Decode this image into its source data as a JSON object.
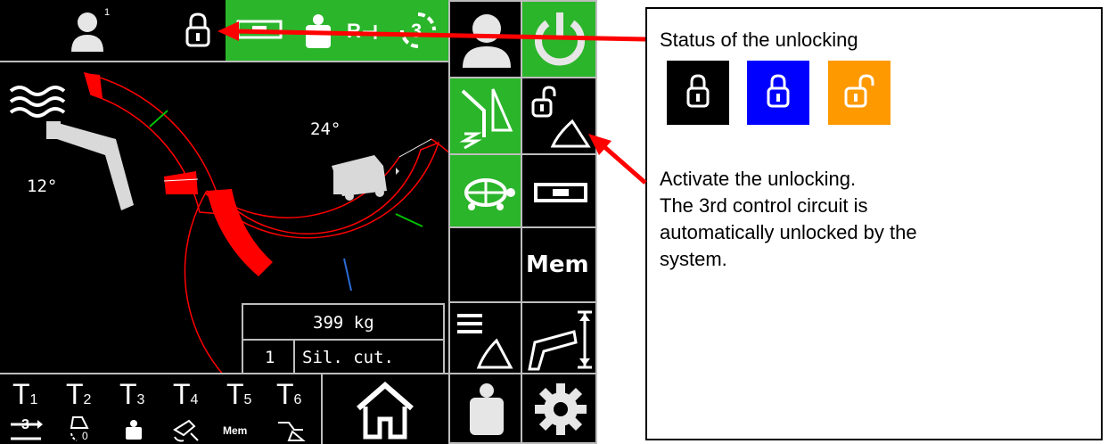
{
  "screen": {
    "top_bar": {
      "user_superscript": "1",
      "active_color": "#2bb52b"
    },
    "gauges": {
      "boom_angle": "12°",
      "slew_angle": "24°"
    },
    "load": {
      "weight": "399 kg",
      "index": "1",
      "mode": "Sil. cut."
    },
    "tools": [
      {
        "label": "T",
        "sub": "1"
      },
      {
        "label": "T",
        "sub": "2"
      },
      {
        "label": "T",
        "sub": "3"
      },
      {
        "label": "T",
        "sub": "4"
      },
      {
        "label": "T",
        "sub": "5"
      },
      {
        "label": "T",
        "sub": "6"
      }
    ],
    "tool_mem": "Mem",
    "side_mem": "Mem",
    "tool_icon_3": "3",
    "tool_icon_2_sub": "0",
    "colors": {
      "green": "#2bb52b",
      "red": "#ff0000",
      "grid_border": "#bdbdbd"
    }
  },
  "annotation": {
    "title": "Status of the unlocking",
    "text_line1": "Activate the unlocking.",
    "text_line2": "The 3rd control circuit is",
    "text_line3": "automatically unlocked by the",
    "text_line4": "system.",
    "swatches": [
      {
        "color": "#000000",
        "icon": "lock-closed-icon"
      },
      {
        "color": "#0000ff",
        "icon": "lock-closed-icon"
      },
      {
        "color": "#ff9900",
        "icon": "lock-open-icon"
      }
    ]
  }
}
